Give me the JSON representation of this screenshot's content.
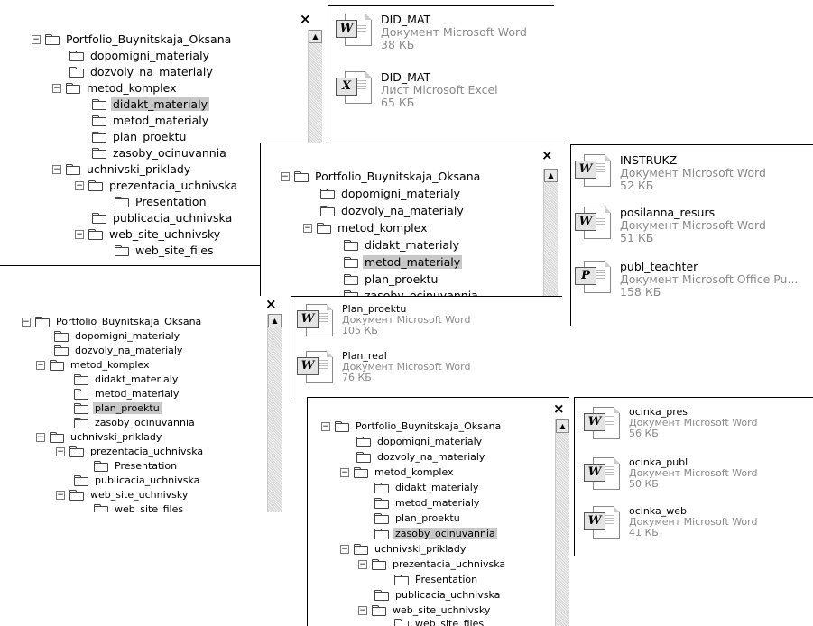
{
  "close_glyph": "×",
  "scroll_up_glyph": "▲",
  "expander_glyph": "−",
  "tree_root": "Portfolio_Buynitskaja_Oksana",
  "tree_items": {
    "dopomigni": "dopomigni_materialy",
    "dozvoly": "dozvoly_na_materialy",
    "metod_komplex": "metod_komplex",
    "didakt": "didakt_materialy",
    "metod_mat": "metod_materialy",
    "plan": "plan_proektu",
    "zasoby": "zasoby_ocinuvannia",
    "uchnivski": "uchnivski_priklady",
    "prezentacia": "prezentacia_uchnivska",
    "presentation": "Presentation",
    "publicacia": "publicacia_uchnivska",
    "web_site": "web_site_uchnivsky",
    "web_files": "web_site_files"
  },
  "windows": [
    {
      "selected": "didakt",
      "files": [
        {
          "name": "DID_MAT",
          "type": "Документ Microsoft Word",
          "size": "38 КБ",
          "icon": "word-doc-icon"
        },
        {
          "name": "DID_MAT",
          "type": "Лист Microsoft Excel",
          "size": "65 КБ",
          "icon": "excel-sheet-icon"
        }
      ]
    },
    {
      "selected": "metod_mat",
      "files": [
        {
          "name": "INSTRUKZ",
          "type": "Документ Microsoft Word",
          "size": "52 КБ",
          "icon": "word-doc-icon"
        },
        {
          "name": "posilanna_resurs",
          "type": "Документ Microsoft Word",
          "size": "51 КБ",
          "icon": "word-doc-icon"
        },
        {
          "name": "publ_teachter",
          "type": "Документ Microsoft Office Pu...",
          "size": "158 КБ",
          "icon": "publisher-doc-icon"
        }
      ]
    },
    {
      "selected": "plan",
      "files": [
        {
          "name": "Plan_proektu",
          "type": "Документ Microsoft Word",
          "size": "105 КБ",
          "icon": "word-doc-icon"
        },
        {
          "name": "Plan_real",
          "type": "Документ Microsoft Word",
          "size": "76 КБ",
          "icon": "word-doc-icon"
        }
      ]
    },
    {
      "selected": "zasoby",
      "files": [
        {
          "name": "ocinka_pres",
          "type": "Документ Microsoft Word",
          "size": "56 КБ",
          "icon": "word-doc-icon"
        },
        {
          "name": "ocinka_publ",
          "type": "Документ Microsoft Word",
          "size": "50 КБ",
          "icon": "word-doc-icon"
        },
        {
          "name": "ocinka_web",
          "type": "Документ Microsoft Word",
          "size": "41 КБ",
          "icon": "word-doc-icon"
        }
      ]
    }
  ],
  "colors": {
    "selection": "#c8c8c8",
    "meta_text": "#8a8a8a"
  }
}
